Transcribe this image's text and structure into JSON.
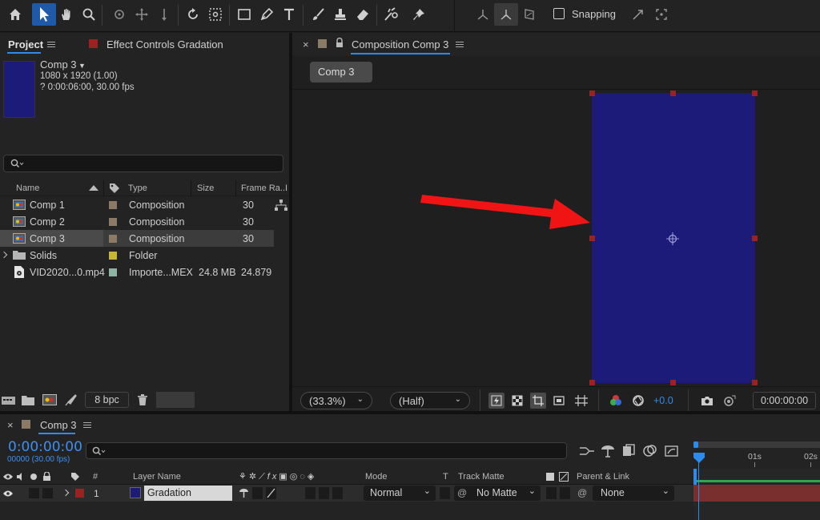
{
  "toolbar": {
    "snapping_label": "Snapping",
    "tools": [
      "home-icon",
      "selection-icon",
      "hand-icon",
      "zoom-icon",
      "orbit-icon",
      "pan-behind-icon",
      "dolly-icon",
      "rotation-icon",
      "anchor-icon",
      "rectangle-icon",
      "pen-icon",
      "type-icon",
      "brush-icon",
      "clone-stamp-icon",
      "eraser-icon",
      "roto-brush-icon",
      "puppet-pin-icon"
    ]
  },
  "project_panel": {
    "tab_label": "Project",
    "effect_controls_label": "Effect Controls Gradation",
    "preview": {
      "name": "Comp 3",
      "dimensions": "1080 x 1920 (1.00)",
      "duration": "? 0:00:06:00, 30.00 fps",
      "thumb_color": "#1c1b7a"
    },
    "columns": {
      "name": "Name",
      "type": "Type",
      "size": "Size",
      "frame_rate": "Frame Ra...",
      "extra": "I"
    },
    "items": [
      {
        "name": "Comp 1",
        "type": "Composition",
        "size": "",
        "frame_rate": "30",
        "label_color": "#8a7a66"
      },
      {
        "name": "Comp 2",
        "type": "Composition",
        "size": "",
        "frame_rate": "30",
        "label_color": "#8a7a66"
      },
      {
        "name": "Comp 3",
        "type": "Composition",
        "size": "",
        "frame_rate": "30",
        "label_color": "#8a7a66"
      },
      {
        "name": "Solids",
        "type": "Folder",
        "size": "",
        "frame_rate": "",
        "label_color": "#c6b53a"
      },
      {
        "name": "VID2020...0.mp4",
        "type": "Importe...MEX",
        "size": "24.8 MB",
        "frame_rate": "24.879",
        "label_color": "#8fb3a3"
      }
    ],
    "bpc_label": "8 bpc"
  },
  "composition_panel": {
    "tab_label": "Composition Comp 3",
    "breadcrumb": "Comp 3",
    "canvas_color": "#1c1b7a",
    "magnification": "(33.3%)",
    "resolution": "(Half)",
    "exposure": "+0.0",
    "timecode": "0:00:00:00"
  },
  "timeline": {
    "tab_label": "Comp 3",
    "timecode": "0:00:00:00",
    "frames": "00000 (30.00 fps)",
    "columns": {
      "number": "#",
      "layer_name": "Layer Name",
      "mode": "Mode",
      "t": "T",
      "track_matte": "Track Matte",
      "parent": "Parent & Link"
    },
    "ruler": [
      "0s",
      "01s",
      "02s"
    ],
    "layers": [
      {
        "index": "1",
        "name": "Gradation",
        "mode": "Normal",
        "track_matte": "No Matte",
        "parent": "None",
        "label_color": "#9c2121",
        "swatch_color": "#1c1b7a"
      }
    ]
  },
  "colors": {
    "accent": "#2d8ceb",
    "arrow": "#f01414",
    "handle": "#9c2121",
    "workarea": "#2ea84a"
  }
}
